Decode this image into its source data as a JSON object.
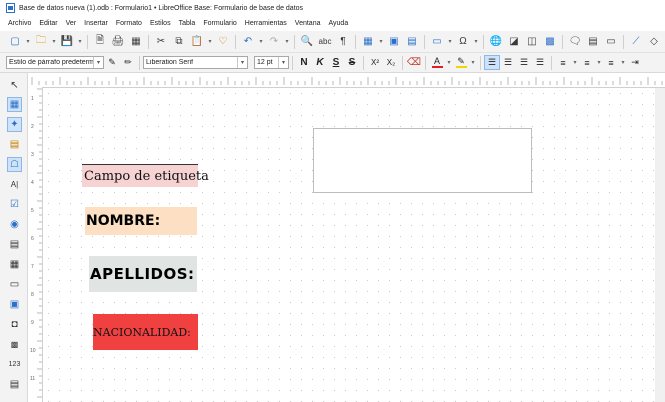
{
  "window": {
    "title": "Base de datos nueva (1).odb : Formulario1 • LibreOffice Base: Formulario de base de datos"
  },
  "menu": [
    "Archivo",
    "Editar",
    "Ver",
    "Insertar",
    "Formato",
    "Estilos",
    "Tabla",
    "Formulario",
    "Herramientas",
    "Ventana",
    "Ayuda"
  ],
  "format_toolbar": {
    "paragraph_style": "Estilo de párrafo predetermin",
    "font_name": "Liberation Serif",
    "font_size": "12 pt",
    "bold": "N",
    "italic": "K",
    "underline": "S",
    "strikethrough": "S",
    "superscript": "X²",
    "subscript": "X₂"
  },
  "colors": {
    "font_color": "#e02020",
    "highlight_color": "#f2d400",
    "selection_blue": "#cfe3f8"
  },
  "form": {
    "labels": [
      {
        "text": "Campo de etiqueta",
        "bg": "#f6d2d2"
      },
      {
        "text": "NOMBRE:",
        "bg": "#fde0c4"
      },
      {
        "text": "APELLIDOS:",
        "bg": "#e0e4e2"
      },
      {
        "text": "NACIONALIDAD:",
        "bg": "#f04040"
      }
    ]
  },
  "ruler": {
    "vertical_numbers": [
      "1",
      "2",
      "3",
      "4",
      "5",
      "6",
      "7",
      "8",
      "9",
      "10",
      "11",
      "12"
    ]
  }
}
